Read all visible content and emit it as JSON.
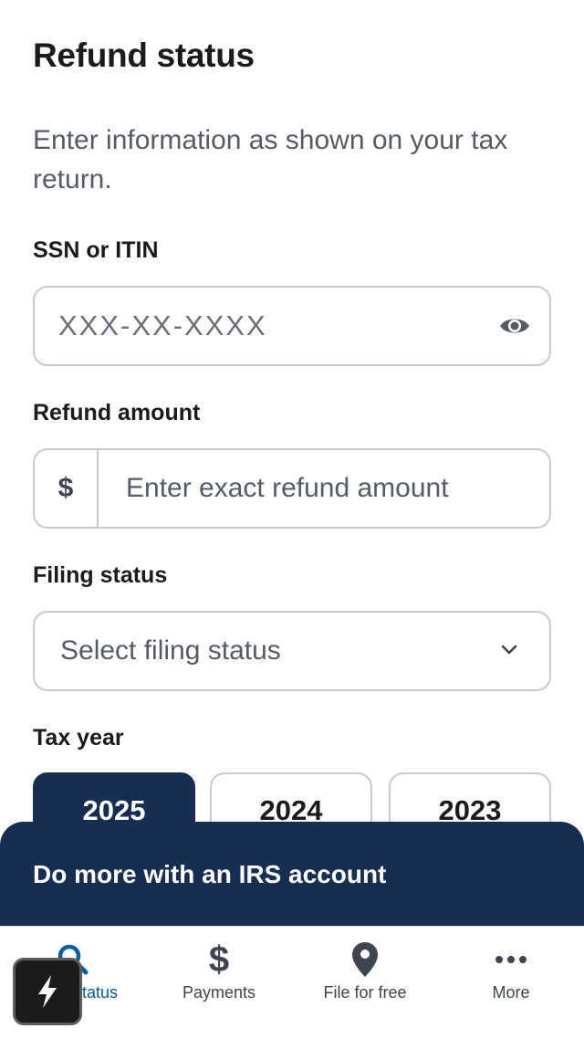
{
  "page": {
    "title": "Refund status",
    "intro": "Enter information as shown on your tax return."
  },
  "form": {
    "ssn": {
      "label": "SSN or ITIN",
      "placeholder": "XXX-XX-XXXX",
      "value": "",
      "toggle_icon": "eye-icon"
    },
    "refund_amount": {
      "label": "Refund amount",
      "prefix": "$",
      "placeholder": "Enter exact refund amount",
      "value": ""
    },
    "filing_status": {
      "label": "Filing status",
      "selected": "Select filing status",
      "icon": "chevron-down-icon"
    },
    "tax_year": {
      "label": "Tax year",
      "options": [
        "2025",
        "2024",
        "2023"
      ],
      "selected": "2025"
    }
  },
  "banner": {
    "text": "Do more with an IRS account"
  },
  "tabbar": {
    "items": [
      {
        "label": "status",
        "icon": "search-icon",
        "active": true
      },
      {
        "label": "Payments",
        "icon": "dollar-icon",
        "active": false
      },
      {
        "label": "File for free",
        "icon": "map-pin-icon",
        "active": false
      },
      {
        "label": "More",
        "icon": "more-dots-icon",
        "active": false
      }
    ]
  },
  "colors": {
    "navy": "#162e51",
    "active_blue": "#005ea2",
    "border": "#c7cacf",
    "muted_text": "#565c65"
  }
}
